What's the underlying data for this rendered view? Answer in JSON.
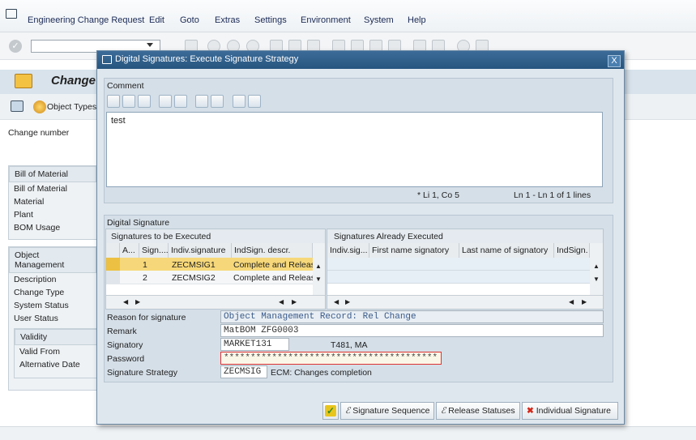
{
  "menu": [
    "Engineering Change Request",
    "Edit",
    "Goto",
    "Extras",
    "Settings",
    "Environment",
    "System",
    "Help"
  ],
  "bg": {
    "title": "Change",
    "object_types_btn": "Object Types",
    "change_number_label": "Change number",
    "bom_section": "Bill of Material",
    "bom_rows": [
      "Bill of Material",
      "Material",
      "Plant",
      "BOM Usage"
    ],
    "objmgmt_section": "Object Management",
    "objmgmt_rows": [
      "Description",
      "Change Type",
      "System Status",
      "User Status"
    ],
    "validity_section": "Validity",
    "validity_rows": [
      "Valid From",
      "Alternative Date"
    ]
  },
  "dialog": {
    "title": "Digital Signatures: Execute Signature Strategy",
    "close": "X",
    "comment": {
      "label": "Comment",
      "text": "test",
      "status_pos": "* Li 1, Co 5",
      "status_lines": "Ln 1 - Ln 1 of 1 lines"
    },
    "digsig": {
      "label": "Digital Signature",
      "left_title": "Signatures to be Executed",
      "left_cols": [
        "A...",
        "Sign....",
        "Indiv.signature",
        "IndSign. descr."
      ],
      "left_rows": [
        {
          "sign": "1",
          "indiv": "ZECMSIG1",
          "descr": "Complete and Release"
        },
        {
          "sign": "2",
          "indiv": "ZECMSIG2",
          "descr": "Complete and Release"
        }
      ],
      "right_title": "Signatures Already Executed",
      "right_cols": [
        "Indiv.sig...",
        "First name signatory",
        "Last name of signatory",
        "IndSign."
      ]
    },
    "form": {
      "reason_label": "Reason for signature",
      "reason_value": "Object Management Record: Rel      Change",
      "remark_label": "Remark",
      "remark_value": "MatBOM      ZFG0003",
      "signatory_label": "Signatory",
      "signatory_value": "MARKET131",
      "signatory_extra": "T481, MA",
      "password_label": "Password",
      "password_value": "****************************************",
      "strategy_label": "Signature Strategy",
      "strategy_value": "ZECMSIG",
      "strategy_desc": "ECM: Changes completion"
    },
    "buttons": {
      "sequence": "Signature Sequence",
      "release": "Release Statuses",
      "individual": "Individual Signature"
    }
  },
  "colors": {
    "title_bar": "#2f5f8c",
    "highlight": "#f6d87a",
    "password_border": "#d33",
    "accent": "#f0c000"
  }
}
